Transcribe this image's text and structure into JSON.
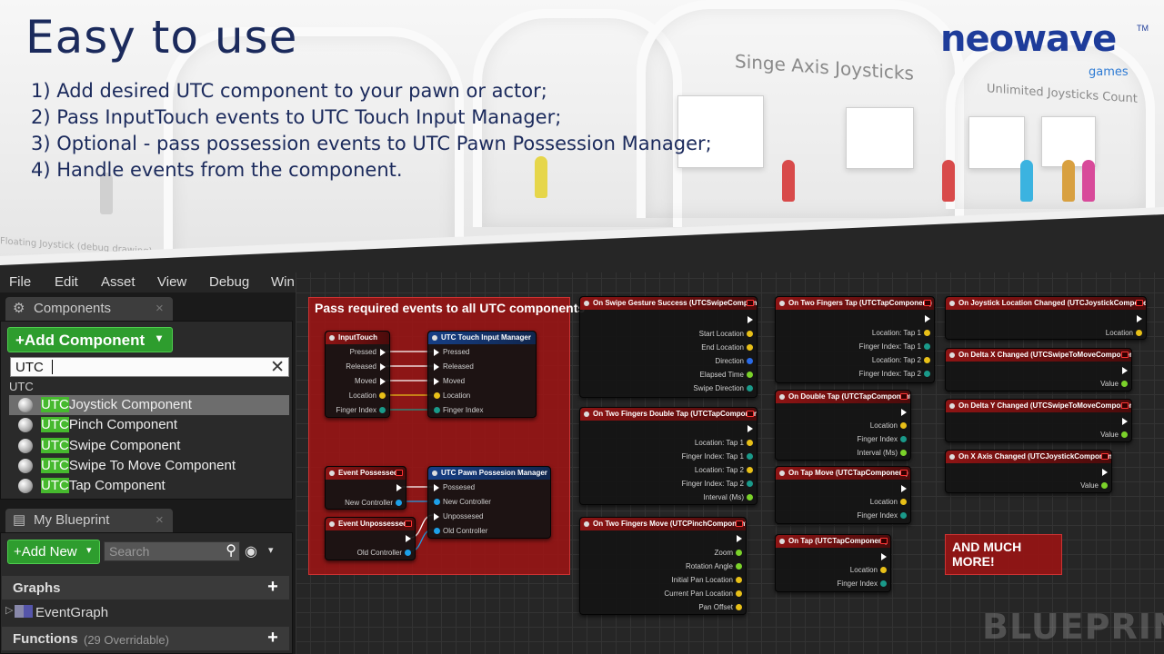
{
  "hero": {
    "title": "Easy to use",
    "steps": [
      "1) Add desired UTC component to your pawn or actor;",
      "2) Pass InputTouch events to UTC Touch Input Manager;",
      "3) Optional - pass possession events to UTC Pawn Possession Manager;",
      "4) Handle events from the component."
    ],
    "bg_text_single_axis": "Singe Axis Joysticks",
    "bg_text_unlimited": "Unlimited Joysticks Count",
    "bg_text_floating": "Floating Joystick (debug drawing)"
  },
  "logo": {
    "main": "neowave",
    "tm": "TM",
    "sub": "games",
    "color": "#1e3c9a"
  },
  "menubar": [
    "File",
    "Edit",
    "Asset",
    "View",
    "Debug",
    "Win"
  ],
  "components_panel": {
    "tab_label": "Components",
    "add_button": "+Add Component",
    "search_value": "UTC",
    "category": "UTC",
    "items": [
      {
        "prefix": "UTC",
        "rest": "Joystick Component"
      },
      {
        "prefix": "UTC",
        "rest": "Pinch Component"
      },
      {
        "prefix": "UTC",
        "rest": "Swipe Component"
      },
      {
        "prefix": "UTC",
        "rest": "Swipe To Move Component"
      },
      {
        "prefix": "UTC",
        "rest": "Tap Component"
      }
    ]
  },
  "blueprint_panel": {
    "tab_label": "My Blueprint",
    "add_new": "+Add New",
    "search_placeholder": "Search",
    "graphs_label": "Graphs",
    "event_graph": "EventGraph",
    "functions_label": "Functions",
    "functions_count": "(29 Overridable)"
  },
  "graph": {
    "comment_title": "Pass required events to all UTC components",
    "more_label": "AND MUCH MORE!",
    "watermark": "BLUEPRINT",
    "nodes": {
      "input_touch": {
        "title": "InputTouch",
        "pins": [
          "Pressed",
          "Released",
          "Moved",
          "Location",
          "Finger Index"
        ]
      },
      "touch_manager": {
        "title": "UTC Touch Input Manager",
        "pins": [
          "Pressed",
          "Released",
          "Moved",
          "Location",
          "Finger Index"
        ]
      },
      "event_possessed": {
        "title": "Event Possessed",
        "pins": [
          "New Controller"
        ]
      },
      "event_unpossessed": {
        "title": "Event Unpossessed",
        "pins": [
          "Old Controller"
        ]
      },
      "possession_manager": {
        "title": "UTC Pawn Possesion Manager",
        "pins": [
          "Possesed",
          "New Controller",
          "Unpossesed",
          "Old Controller"
        ]
      },
      "swipe_success": {
        "title": "On Swipe Gesture Success (UTCSwipeComponent)",
        "pins": [
          "Start Location",
          "End Location",
          "Direction",
          "Elapsed Time",
          "Swipe Direction"
        ]
      },
      "two_double_tap": {
        "title": "On Two Fingers Double Tap (UTCTapComponent)",
        "pins": [
          "Location: Tap 1",
          "Finger Index: Tap 1",
          "Location: Tap 2",
          "Finger Index: Tap 2",
          "Interval (Ms)"
        ]
      },
      "two_move": {
        "title": "On Two Fingers Move (UTCPinchComponent)",
        "pins": [
          "Zoom",
          "Rotation Angle",
          "Initial Pan Location",
          "Current Pan Location",
          "Pan Offset"
        ]
      },
      "two_tap": {
        "title": "On Two Fingers Tap (UTCTapComponent)",
        "pins": [
          "Location: Tap 1",
          "Finger Index: Tap 1",
          "Location: Tap 2",
          "Finger Index: Tap 2"
        ]
      },
      "double_tap": {
        "title": "On Double Tap (UTCTapComponent)",
        "pins": [
          "Location",
          "Finger Index",
          "Interval (Ms)"
        ]
      },
      "tap_move": {
        "title": "On Tap Move (UTCTapComponent)",
        "pins": [
          "Location",
          "Finger Index"
        ]
      },
      "on_tap": {
        "title": "On Tap (UTCTapComponent)",
        "pins": [
          "Location",
          "Finger Index"
        ]
      },
      "joy_loc": {
        "title": "On Joystick Location Changed (UTCJoystickComponent)",
        "pins": [
          "Location"
        ]
      },
      "delta_x": {
        "title": "On Delta X Changed (UTCSwipeToMoveComponent)",
        "pins": [
          "Value"
        ]
      },
      "delta_y": {
        "title": "On Delta Y Changed (UTCSwipeToMoveComponent)",
        "pins": [
          "Value"
        ]
      },
      "x_axis": {
        "title": "On X Axis Changed (UTCJoystickComponent)",
        "pins": [
          "Value"
        ]
      }
    }
  },
  "colors": {
    "accent_green": "#2e9d2e",
    "highlight_green": "#46b92e",
    "comment_red": "#a01414",
    "title_navy": "#1b2a5c"
  }
}
